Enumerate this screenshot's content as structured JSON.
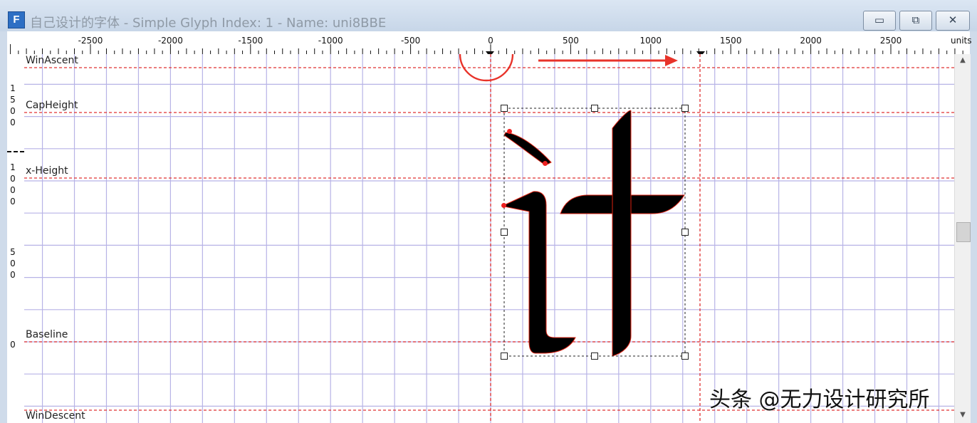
{
  "window": {
    "title": "自己设计的字体 - Simple Glyph Index: 1 - Name: uni8BBE",
    "app_icon": "F",
    "controls": {
      "minimize": "▭",
      "maximize": "⧉",
      "close": "✕"
    }
  },
  "ruler": {
    "unit_label": "units",
    "ticks": [
      {
        "value": -2500,
        "label": "-2500"
      },
      {
        "value": -2000,
        "label": "-2000"
      },
      {
        "value": -1500,
        "label": "-1500"
      },
      {
        "value": -1000,
        "label": "-1000"
      },
      {
        "value": -500,
        "label": "-500"
      },
      {
        "value": 0,
        "label": "0"
      },
      {
        "value": 500,
        "label": "500"
      },
      {
        "value": 1000,
        "label": "1000"
      },
      {
        "value": 1500,
        "label": "1500"
      },
      {
        "value": 2000,
        "label": "2000"
      },
      {
        "value": 2500,
        "label": "2500"
      }
    ],
    "vertical_labels": [
      "1500",
      "1000",
      "500",
      "0"
    ]
  },
  "metrics": {
    "win_ascent": "WinAscent",
    "cap_height": "CapHeight",
    "x_height": "x-Height",
    "baseline": "Baseline",
    "win_descent": "WinDescent"
  },
  "glyph": {
    "name": "uni8BBE",
    "character": "计"
  },
  "annotation": {
    "highlight": "origin-circle",
    "arrow_direction": "right"
  },
  "watermark": "头条 @无力设计研究所",
  "colors": {
    "grid": "#b7b3e6",
    "metric_line": "#e03030",
    "glyph": "#000000",
    "annotation": "#e8332a"
  },
  "icons": {
    "scroll_up": "arrow-up-icon",
    "scroll_down": "arrow-down-icon"
  }
}
